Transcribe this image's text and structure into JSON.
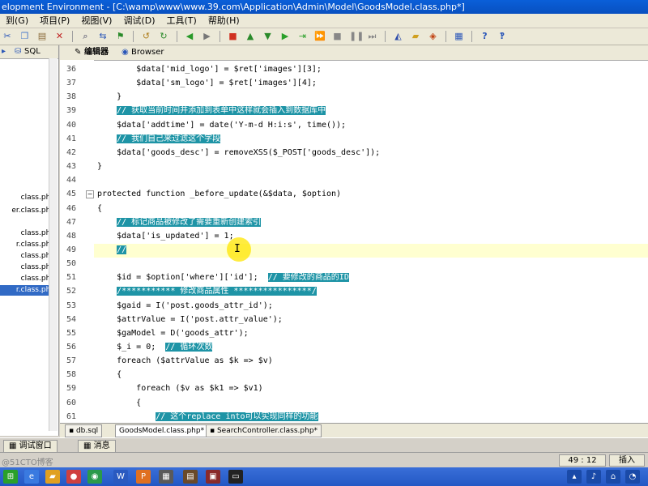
{
  "window": {
    "title": "elopment Environment - [C:\\wamp\\www\\www.39.com\\Application\\Admin\\Model\\GoodsModel.class.php*]"
  },
  "menu": [
    "到(G)",
    "项目(P)",
    "视图(V)",
    "调试(D)",
    "工具(T)",
    "帮助(H)"
  ],
  "left_panel": {
    "sql_tab": "SQL",
    "files": [
      "class.php",
      "er.class.php",
      "class.php",
      "r.class.php",
      "class.php",
      "class.php",
      "class.php",
      "r.class.php"
    ]
  },
  "editor_tabs": [
    "编辑器",
    "Browser"
  ],
  "code_lines": [
    {
      "n": "36",
      "text": "        $data['mid_logo'] = $ret['images'][3];",
      "comment": false
    },
    {
      "n": "37",
      "text": "        $data['sm_logo'] = $ret['images'][4];",
      "comment": false
    },
    {
      "n": "38",
      "text": "    }",
      "comment": false
    },
    {
      "n": "39",
      "text": "    // 获取当前时间并添加到表单中这样就会插入到数据库中",
      "comment": true
    },
    {
      "n": "40",
      "text": "    $data['addtime'] = date('Y-m-d H:i:s', time());",
      "comment": false
    },
    {
      "n": "41",
      "text": "    // 我们自己来过滤这个字段",
      "comment": true
    },
    {
      "n": "42",
      "text": "    $data['goods_desc'] = removeXSS($_POST['goods_desc']);",
      "comment": false
    },
    {
      "n": "43",
      "text": "}",
      "comment": false
    },
    {
      "n": "44",
      "text": "",
      "comment": false
    },
    {
      "n": "45",
      "text": "protected function _before_update(&$data, $option)",
      "comment": false
    },
    {
      "n": "46",
      "text": "{",
      "comment": false
    },
    {
      "n": "47",
      "text": "    // 标记商品被修改了需要重新创建索引",
      "comment": true
    },
    {
      "n": "48",
      "text": "    $data['is_updated'] = 1;",
      "comment": false
    },
    {
      "n": "49",
      "text": "    //",
      "comment": true
    },
    {
      "n": "50",
      "text": "",
      "comment": false
    },
    {
      "n": "51",
      "text": "    $id = $option['where']['id'];  ",
      "comment": false,
      "trailing_comment": "// 要修改的商品的ID"
    },
    {
      "n": "52",
      "text": "    /*********** 修改商品属性 ****************/",
      "comment": true
    },
    {
      "n": "53",
      "text": "    $gaid = I('post.goods_attr_id');",
      "comment": false
    },
    {
      "n": "54",
      "text": "    $attrValue = I('post.attr_value');",
      "comment": false
    },
    {
      "n": "55",
      "text": "    $gaModel = D('goods_attr');",
      "comment": false
    },
    {
      "n": "56",
      "text": "    $_i = 0;  ",
      "comment": false,
      "trailing_comment": "// 循环次数"
    },
    {
      "n": "57",
      "text": "    foreach ($attrValue as $k => $v)",
      "comment": false
    },
    {
      "n": "58",
      "text": "    {",
      "comment": false
    },
    {
      "n": "59",
      "text": "        foreach ($v as $k1 => $v1)",
      "comment": false
    },
    {
      "n": "60",
      "text": "        {",
      "comment": false
    },
    {
      "n": "61",
      "text": "            // 这个replace into可以实现同样的功能",
      "comment": true
    }
  ],
  "bottom_tabs": [
    "db.sql",
    "GoodsModel.class.php*",
    "SearchController.class.php*"
  ],
  "lower_tabs": [
    "调试窗口",
    "消息"
  ],
  "status": {
    "position": "49 : 12",
    "mode": "插入"
  },
  "watermark": "@51CTO博客",
  "colors": {
    "comment_bg": "#1e94a6",
    "selection": "#316ac5",
    "current_line": "#ffffd0"
  }
}
